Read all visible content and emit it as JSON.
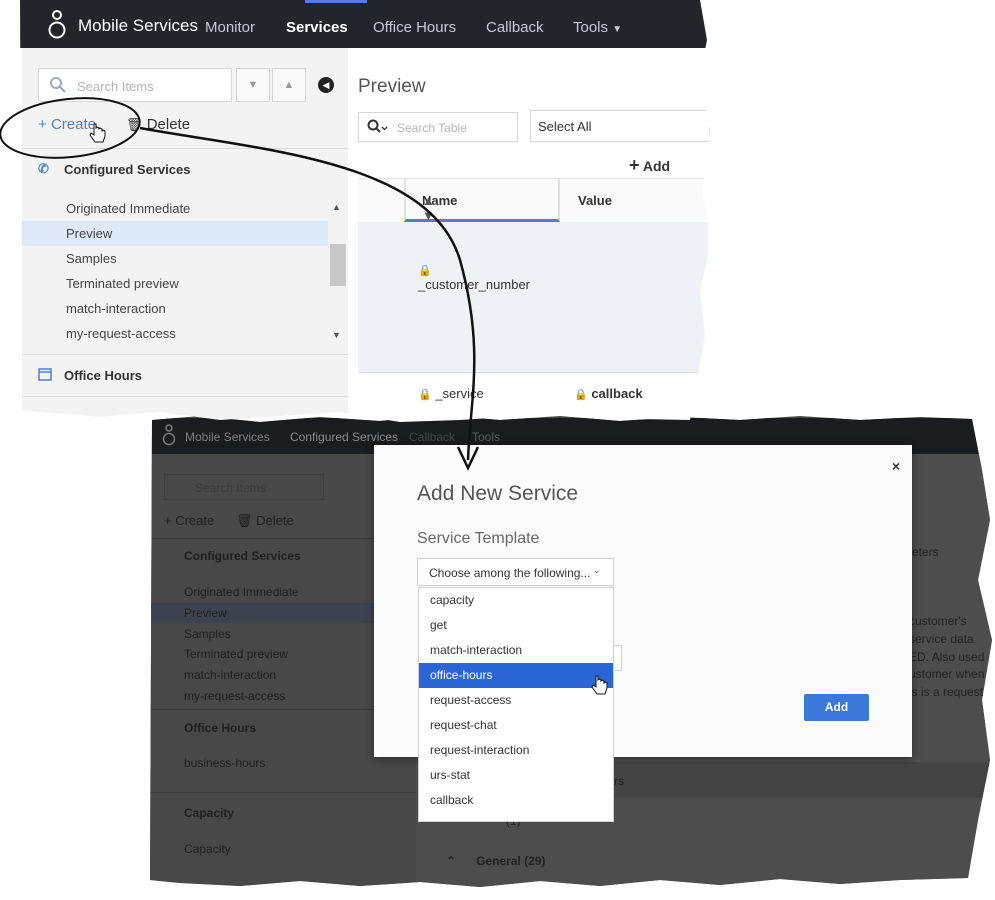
{
  "top": {
    "navbar": {
      "brand": "Mobile Services",
      "items": [
        {
          "label": "Monitor",
          "active": false
        },
        {
          "label": "Services",
          "active": true
        },
        {
          "label": "Office Hours",
          "active": false
        },
        {
          "label": "Callback",
          "active": false
        },
        {
          "label": "Tools",
          "active": false,
          "has_caret": true
        }
      ]
    },
    "sidebar": {
      "search_placeholder": "Search Items",
      "create_label": "Create",
      "delete_label": "Delete",
      "configured_services_label": "Configured Services",
      "services": [
        "Originated Immediate",
        "Preview",
        "Samples",
        "Terminated preview",
        "match-interaction",
        "my-request-access"
      ],
      "selected_service": "Preview",
      "office_hours_label": "Office Hours"
    },
    "main": {
      "title": "Preview",
      "table_search_placeholder": "Search Table",
      "select_value": "Select All",
      "add_label": "Add",
      "columns": [
        "Name",
        "Value"
      ],
      "rows": [
        {
          "name": "_customer_number",
          "value": ""
        },
        {
          "name": "_service",
          "value": "callback"
        }
      ]
    }
  },
  "bottom": {
    "navbar": {
      "brand": "Mobile Services",
      "items": [
        "Configured Services",
        "Callback",
        "Tools"
      ]
    },
    "sidebar": {
      "search_placeholder": "Search Items",
      "create_label": "Create",
      "delete_label": "Delete",
      "configured_services_label": "Configured Services",
      "services": [
        "Originated Immediate",
        "Preview",
        "Samples",
        "Terminated preview",
        "match-interaction",
        "my-request-access"
      ],
      "office_hours_label": "Office Hours",
      "office_hours_items": [
        "business-hours"
      ],
      "capacity_label": "Capacity",
      "capacity_items": [
        "Capacity"
      ]
    },
    "main": {
      "params_label": "eters",
      "background_text": [
        "customer's",
        "service data",
        "ED. Also used",
        "ustomer when",
        "is is a request p"
      ],
      "group_band_text": "rs",
      "group_band_text2": "(1)",
      "general_label": "General (29)"
    },
    "modal": {
      "title": "Add New Service",
      "service_template_label": "Service Template",
      "dropdown_value": "Choose among the following...",
      "options": [
        "capacity",
        "get",
        "match-interaction",
        "office-hours",
        "request-access",
        "request-chat",
        "request-interaction",
        "urs-stat",
        "callback"
      ],
      "highlighted_option": "office-hours",
      "add_button": "Add",
      "close": "×"
    }
  },
  "colors": {
    "accent": "#4d7fd8",
    "navbar_bg": "#22252a",
    "selected_row": "#dde8f8",
    "highlight_option": "#2a66d6"
  }
}
